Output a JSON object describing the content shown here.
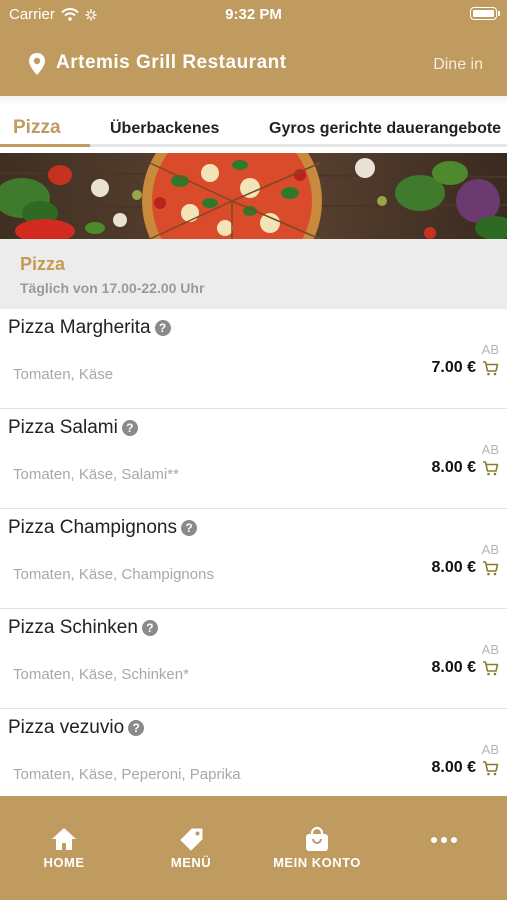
{
  "status_bar": {
    "carrier": "Carrier",
    "time": "9:32 PM"
  },
  "header": {
    "title": "Artemis Grill Restaurant",
    "mode": "Dine in"
  },
  "tabs": [
    {
      "label": "Pizza",
      "active": true
    },
    {
      "label": "Überbackenes",
      "active": false
    },
    {
      "label": "Gyros gerichte dauerangebote",
      "active": false
    }
  ],
  "category": {
    "name": "Pizza",
    "hours": "Täglich von 17.00-22.00 Uhr"
  },
  "items": [
    {
      "name": "Pizza Margherita",
      "description": "Tomaten, Käse",
      "price_prefix": "AB",
      "price": "7.00 €"
    },
    {
      "name": "Pizza Salami",
      "description": "Tomaten, Käse, Salami**",
      "price_prefix": "AB",
      "price": "8.00 €"
    },
    {
      "name": "Pizza Champignons",
      "description": "Tomaten, Käse, Champignons",
      "price_prefix": "AB",
      "price": "8.00 €"
    },
    {
      "name": "Pizza Schinken",
      "description": "Tomaten, Käse, Schinken*",
      "price_prefix": "AB",
      "price": "8.00 €"
    },
    {
      "name": "Pizza vezuvio",
      "description": "Tomaten, Käse, Peperoni, Paprika",
      "price_prefix": "AB",
      "price": "8.00 €"
    }
  ],
  "bottom_nav": [
    {
      "label": "HOME",
      "icon": "home-icon"
    },
    {
      "label": "MENÜ",
      "icon": "tag-icon"
    },
    {
      "label": "MEIN KONTO",
      "icon": "shopping-bag-icon"
    },
    {
      "label": "",
      "icon": "more-icon"
    }
  ],
  "colors": {
    "brand": "#bf9b5f",
    "category_title": "#c79a4f",
    "cart_icon": "#8a7a2a",
    "category_bg": "#ececec"
  }
}
